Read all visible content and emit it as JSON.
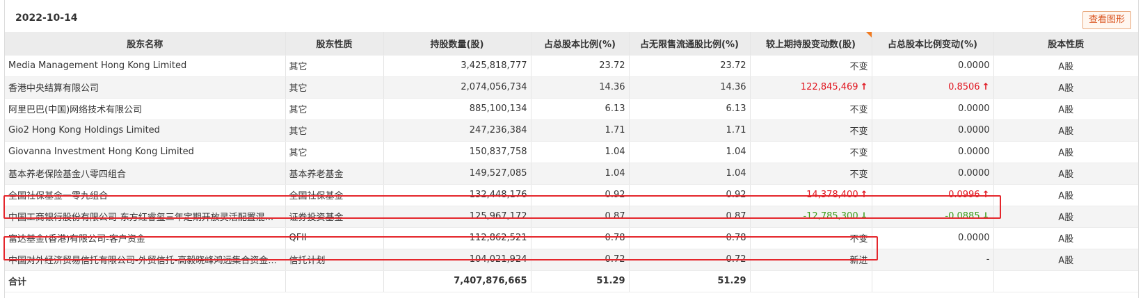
{
  "header": {
    "date": "2022-10-14",
    "chart_button": "查看图形"
  },
  "columns": [
    "股东名称",
    "股东性质",
    "持股数量(股)",
    "占总股本比例(%)",
    "占无限售流通股比例(%)",
    "较上期持股变动数(股)",
    "占总股本比例变动(%)",
    "股本性质"
  ],
  "rows": [
    {
      "name": "Media Management Hong Kong Limited",
      "nature": "其它",
      "shares": "3,425,818,777",
      "total_pct": "23.72",
      "float_pct": "23.72",
      "change": "不变",
      "change_dir": "",
      "pct_change": "0.0000",
      "pct_dir": "",
      "share_type": "A股"
    },
    {
      "name": "香港中央结算有限公司",
      "nature": "其它",
      "shares": "2,074,056,734",
      "total_pct": "14.36",
      "float_pct": "14.36",
      "change": "122,845,469",
      "change_dir": "up",
      "pct_change": "0.8506",
      "pct_dir": "up",
      "share_type": "A股"
    },
    {
      "name": "阿里巴巴(中国)网络技术有限公司",
      "nature": "其它",
      "shares": "885,100,134",
      "total_pct": "6.13",
      "float_pct": "6.13",
      "change": "不变",
      "change_dir": "",
      "pct_change": "0.0000",
      "pct_dir": "",
      "share_type": "A股"
    },
    {
      "name": "Gio2 Hong Kong Holdings Limited",
      "nature": "其它",
      "shares": "247,236,384",
      "total_pct": "1.71",
      "float_pct": "1.71",
      "change": "不变",
      "change_dir": "",
      "pct_change": "0.0000",
      "pct_dir": "",
      "share_type": "A股"
    },
    {
      "name": "Giovanna Investment Hong Kong Limited",
      "nature": "其它",
      "shares": "150,837,758",
      "total_pct": "1.04",
      "float_pct": "1.04",
      "change": "不变",
      "change_dir": "",
      "pct_change": "0.0000",
      "pct_dir": "",
      "share_type": "A股"
    },
    {
      "name": "基本养老保险基金八零四组合",
      "nature": "基本养老基金",
      "shares": "149,527,085",
      "total_pct": "1.04",
      "float_pct": "1.04",
      "change": "不变",
      "change_dir": "",
      "pct_change": "0.0000",
      "pct_dir": "",
      "share_type": "A股"
    },
    {
      "name": "全国社保基金一零九组合",
      "nature": "全国社保基金",
      "shares": "132,448,176",
      "total_pct": "0.92",
      "float_pct": "0.92",
      "change": "14,378,400",
      "change_dir": "up",
      "pct_change": "0.0996",
      "pct_dir": "up",
      "share_type": "A股"
    },
    {
      "name": "中国工商银行股份有限公司-东方红睿玺三年定期开放灵活配置混...",
      "nature": "证券投资基金",
      "shares": "125,967,172",
      "total_pct": "0.87",
      "float_pct": "0.87",
      "change": "-12,785,300",
      "change_dir": "down",
      "pct_change": "-0.0885",
      "pct_dir": "down",
      "share_type": "A股"
    },
    {
      "name": "富达基金(香港)有限公司-客户资金",
      "nature": "QFII",
      "shares": "112,862,521",
      "total_pct": "0.78",
      "float_pct": "0.78",
      "change": "不变",
      "change_dir": "",
      "pct_change": "0.0000",
      "pct_dir": "",
      "share_type": "A股"
    },
    {
      "name": "中国对外经济贸易信托有限公司-外贸信托-高毅晓峰鸿远集合资金...",
      "nature": "信托计划",
      "shares": "104,021,924",
      "total_pct": "0.72",
      "float_pct": "0.72",
      "change": "新进",
      "change_dir": "",
      "pct_change": "-",
      "pct_dir": "",
      "share_type": "A股"
    }
  ],
  "total": {
    "label": "合计",
    "shares": "7,407,876,665",
    "total_pct": "51.29",
    "float_pct": "51.29"
  },
  "colors": {
    "up": "#e0141e",
    "down": "#3c9a1a",
    "highlight_box": "#e4262c",
    "accent": "#d9521c"
  },
  "icons": {
    "up": "arrow-up-icon",
    "down": "arrow-down-icon"
  }
}
